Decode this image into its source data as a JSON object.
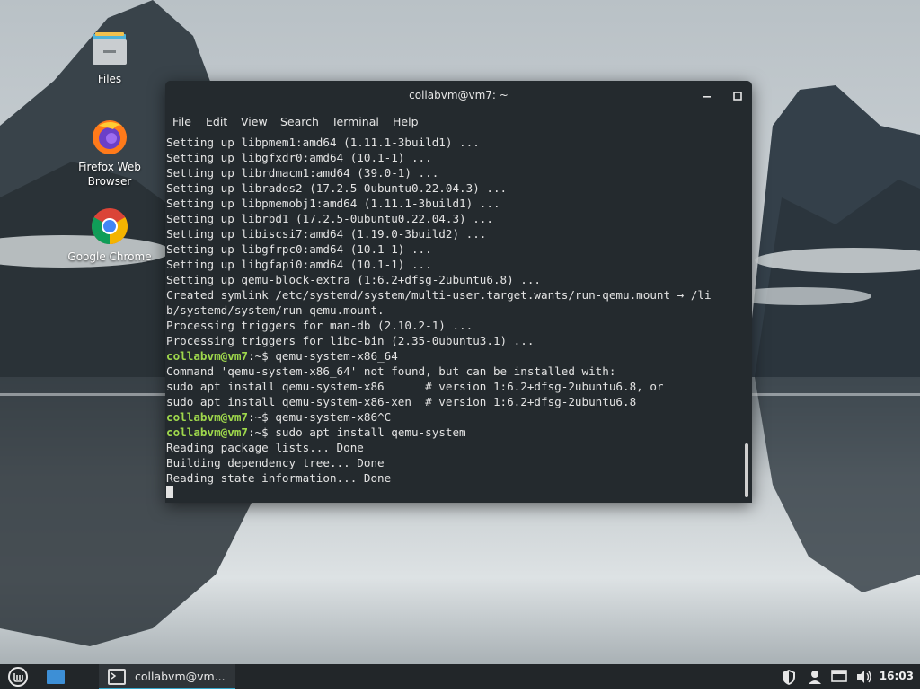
{
  "desktop": {
    "icons": [
      {
        "label": "Files",
        "icon": "folder-icon"
      },
      {
        "label": "Firefox Web Browser",
        "icon": "firefox-icon"
      },
      {
        "label": "Google Chrome",
        "icon": "chrome-icon"
      }
    ]
  },
  "terminal": {
    "title": "collabvm@vm7: ~",
    "controls": {
      "minimize": "minimize-icon",
      "maximize": "maximize-icon",
      "close": "close-icon"
    },
    "menu": [
      "File",
      "Edit",
      "View",
      "Search",
      "Terminal",
      "Help"
    ],
    "lines": [
      {
        "text": "Setting up libpmem1:amd64 (1.11.1-3build1) ..."
      },
      {
        "text": "Setting up libgfxdr0:amd64 (10.1-1) ..."
      },
      {
        "text": "Setting up librdmacm1:amd64 (39.0-1) ..."
      },
      {
        "text": "Setting up librados2 (17.2.5-0ubuntu0.22.04.3) ..."
      },
      {
        "text": "Setting up libpmemobj1:amd64 (1.11.1-3build1) ..."
      },
      {
        "text": "Setting up librbd1 (17.2.5-0ubuntu0.22.04.3) ..."
      },
      {
        "text": "Setting up libiscsi7:amd64 (1.19.0-3build2) ..."
      },
      {
        "text": "Setting up libgfrpc0:amd64 (10.1-1) ..."
      },
      {
        "text": "Setting up libgfapi0:amd64 (10.1-1) ..."
      },
      {
        "text": "Setting up qemu-block-extra (1:6.2+dfsg-2ubuntu6.8) ..."
      },
      {
        "text": "Created symlink /etc/systemd/system/multi-user.target.wants/run-qemu.mount → /li"
      },
      {
        "text": "b/systemd/system/run-qemu.mount."
      },
      {
        "text": "Processing triggers for man-db (2.10.2-1) ..."
      },
      {
        "text": "Processing triggers for libc-bin (2.35-0ubuntu3.1) ..."
      },
      {
        "prompt": "collabvm@vm7",
        "suffix": ":~$ ",
        "text": "qemu-system-x86_64"
      },
      {
        "text": "Command 'qemu-system-x86_64' not found, but can be installed with:"
      },
      {
        "text": "sudo apt install qemu-system-x86      # version 1:6.2+dfsg-2ubuntu6.8, or"
      },
      {
        "text": "sudo apt install qemu-system-x86-xen  # version 1:6.2+dfsg-2ubuntu6.8"
      },
      {
        "prompt": "collabvm@vm7",
        "suffix": ":~$ ",
        "text": "qemu-system-x86^C"
      },
      {
        "prompt": "collabvm@vm7",
        "suffix": ":~$ ",
        "text": "sudo apt install qemu-system"
      },
      {
        "text": "Reading package lists... Done"
      },
      {
        "text": "Building dependency tree... Done"
      },
      {
        "text": "Reading state information... Done"
      }
    ]
  },
  "taskbar": {
    "menu_icon": "mint-menu-icon",
    "show_desktop_icon": "show-desktop-icon",
    "task_label": "collabvm@vm...",
    "task_icon": "terminal-icon",
    "tray": [
      "shield-icon",
      "user-icon",
      "display-icon",
      "volume-icon"
    ],
    "clock": "16:03",
    "accent": "#35a6c9"
  },
  "colors": {
    "prompt": "#9fd84c",
    "terminal_bg": "#242a2e",
    "taskbar_bg": "#222629"
  }
}
